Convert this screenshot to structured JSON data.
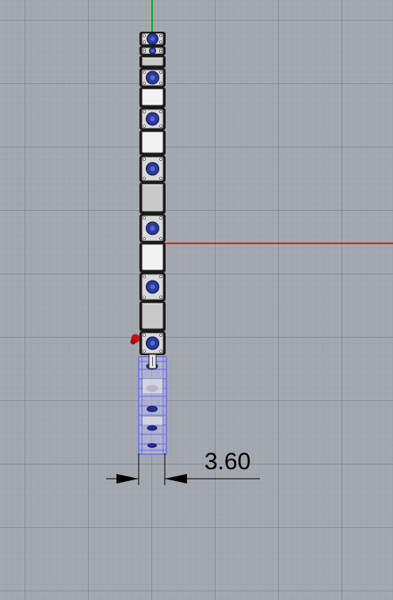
{
  "viewport": {
    "dimension_value": "3.60",
    "colors": {
      "background": "#a4a9b0",
      "x_axis": "#d60000",
      "y_axis": "#00a000",
      "module_frame": "#1a1a1a",
      "module_face_light": "#f2f2f2",
      "module_face_gray": "#c9c9c9",
      "module_hub_blue": "#2a3a9c",
      "ghost_preview": "#6a6aee",
      "gizmo_red": "#cc1111"
    }
  }
}
